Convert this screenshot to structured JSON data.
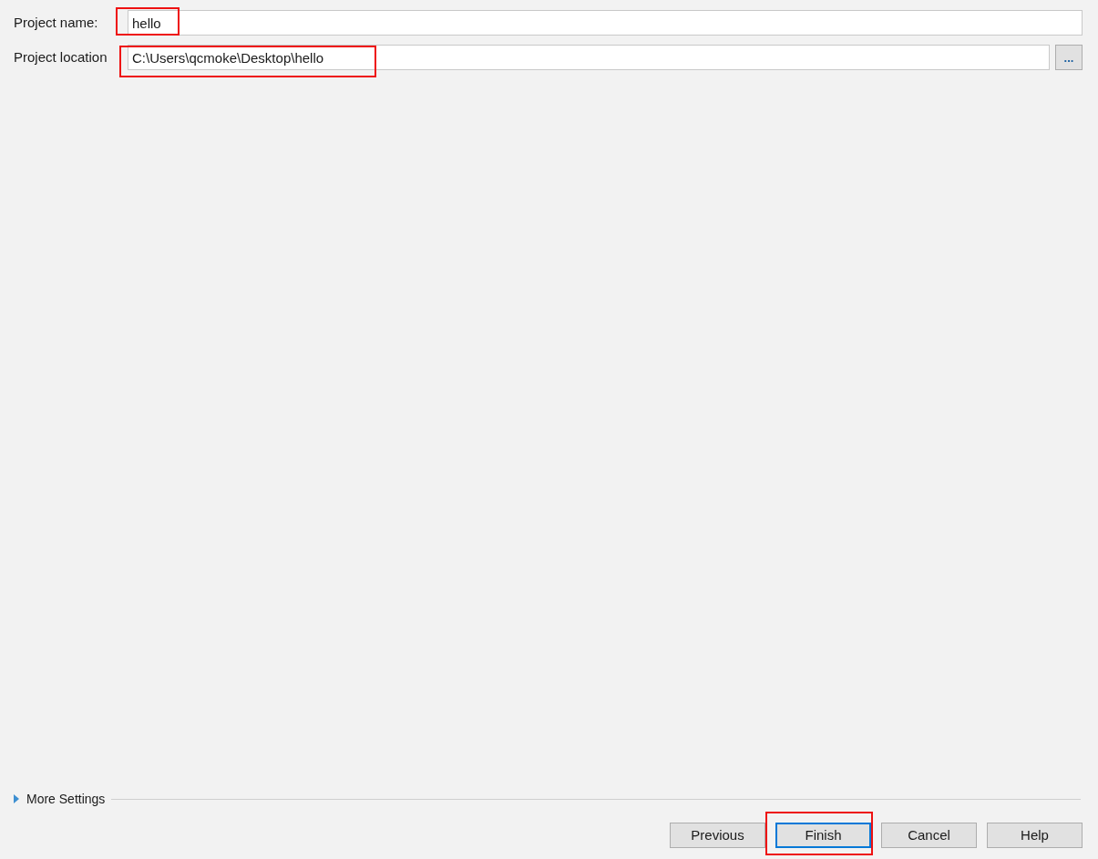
{
  "fields": [
    {
      "label": "Project name:",
      "value": "hello",
      "highlighted": true
    },
    {
      "label": "Project location",
      "value": "C:\\Users\\qcmoke\\Desktop\\hello",
      "highlighted": true,
      "browse": "..."
    }
  ],
  "more_settings": {
    "label": "More Settings",
    "expanded": false
  },
  "buttons": [
    {
      "label": "Previous",
      "focused": false,
      "highlighted": false
    },
    {
      "label": "Finish",
      "focused": true,
      "highlighted": true
    },
    {
      "label": "Cancel",
      "focused": false,
      "highlighted": false
    },
    {
      "label": "Help",
      "focused": false,
      "highlighted": false
    }
  ]
}
